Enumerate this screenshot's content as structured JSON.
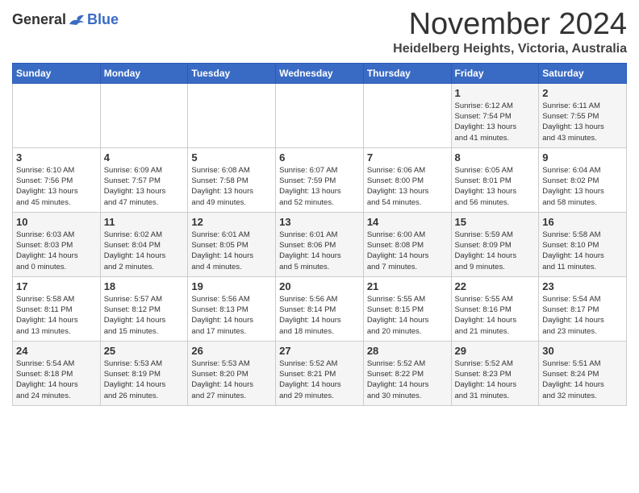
{
  "logo": {
    "general": "General",
    "blue": "Blue"
  },
  "header": {
    "month": "November 2024",
    "location": "Heidelberg Heights, Victoria, Australia"
  },
  "weekdays": [
    "Sunday",
    "Monday",
    "Tuesday",
    "Wednesday",
    "Thursday",
    "Friday",
    "Saturday"
  ],
  "weeks": [
    [
      {
        "day": "",
        "info": ""
      },
      {
        "day": "",
        "info": ""
      },
      {
        "day": "",
        "info": ""
      },
      {
        "day": "",
        "info": ""
      },
      {
        "day": "",
        "info": ""
      },
      {
        "day": "1",
        "info": "Sunrise: 6:12 AM\nSunset: 7:54 PM\nDaylight: 13 hours\nand 41 minutes."
      },
      {
        "day": "2",
        "info": "Sunrise: 6:11 AM\nSunset: 7:55 PM\nDaylight: 13 hours\nand 43 minutes."
      }
    ],
    [
      {
        "day": "3",
        "info": "Sunrise: 6:10 AM\nSunset: 7:56 PM\nDaylight: 13 hours\nand 45 minutes."
      },
      {
        "day": "4",
        "info": "Sunrise: 6:09 AM\nSunset: 7:57 PM\nDaylight: 13 hours\nand 47 minutes."
      },
      {
        "day": "5",
        "info": "Sunrise: 6:08 AM\nSunset: 7:58 PM\nDaylight: 13 hours\nand 49 minutes."
      },
      {
        "day": "6",
        "info": "Sunrise: 6:07 AM\nSunset: 7:59 PM\nDaylight: 13 hours\nand 52 minutes."
      },
      {
        "day": "7",
        "info": "Sunrise: 6:06 AM\nSunset: 8:00 PM\nDaylight: 13 hours\nand 54 minutes."
      },
      {
        "day": "8",
        "info": "Sunrise: 6:05 AM\nSunset: 8:01 PM\nDaylight: 13 hours\nand 56 minutes."
      },
      {
        "day": "9",
        "info": "Sunrise: 6:04 AM\nSunset: 8:02 PM\nDaylight: 13 hours\nand 58 minutes."
      }
    ],
    [
      {
        "day": "10",
        "info": "Sunrise: 6:03 AM\nSunset: 8:03 PM\nDaylight: 14 hours\nand 0 minutes."
      },
      {
        "day": "11",
        "info": "Sunrise: 6:02 AM\nSunset: 8:04 PM\nDaylight: 14 hours\nand 2 minutes."
      },
      {
        "day": "12",
        "info": "Sunrise: 6:01 AM\nSunset: 8:05 PM\nDaylight: 14 hours\nand 4 minutes."
      },
      {
        "day": "13",
        "info": "Sunrise: 6:01 AM\nSunset: 8:06 PM\nDaylight: 14 hours\nand 5 minutes."
      },
      {
        "day": "14",
        "info": "Sunrise: 6:00 AM\nSunset: 8:08 PM\nDaylight: 14 hours\nand 7 minutes."
      },
      {
        "day": "15",
        "info": "Sunrise: 5:59 AM\nSunset: 8:09 PM\nDaylight: 14 hours\nand 9 minutes."
      },
      {
        "day": "16",
        "info": "Sunrise: 5:58 AM\nSunset: 8:10 PM\nDaylight: 14 hours\nand 11 minutes."
      }
    ],
    [
      {
        "day": "17",
        "info": "Sunrise: 5:58 AM\nSunset: 8:11 PM\nDaylight: 14 hours\nand 13 minutes."
      },
      {
        "day": "18",
        "info": "Sunrise: 5:57 AM\nSunset: 8:12 PM\nDaylight: 14 hours\nand 15 minutes."
      },
      {
        "day": "19",
        "info": "Sunrise: 5:56 AM\nSunset: 8:13 PM\nDaylight: 14 hours\nand 17 minutes."
      },
      {
        "day": "20",
        "info": "Sunrise: 5:56 AM\nSunset: 8:14 PM\nDaylight: 14 hours\nand 18 minutes."
      },
      {
        "day": "21",
        "info": "Sunrise: 5:55 AM\nSunset: 8:15 PM\nDaylight: 14 hours\nand 20 minutes."
      },
      {
        "day": "22",
        "info": "Sunrise: 5:55 AM\nSunset: 8:16 PM\nDaylight: 14 hours\nand 21 minutes."
      },
      {
        "day": "23",
        "info": "Sunrise: 5:54 AM\nSunset: 8:17 PM\nDaylight: 14 hours\nand 23 minutes."
      }
    ],
    [
      {
        "day": "24",
        "info": "Sunrise: 5:54 AM\nSunset: 8:18 PM\nDaylight: 14 hours\nand 24 minutes."
      },
      {
        "day": "25",
        "info": "Sunrise: 5:53 AM\nSunset: 8:19 PM\nDaylight: 14 hours\nand 26 minutes."
      },
      {
        "day": "26",
        "info": "Sunrise: 5:53 AM\nSunset: 8:20 PM\nDaylight: 14 hours\nand 27 minutes."
      },
      {
        "day": "27",
        "info": "Sunrise: 5:52 AM\nSunset: 8:21 PM\nDaylight: 14 hours\nand 29 minutes."
      },
      {
        "day": "28",
        "info": "Sunrise: 5:52 AM\nSunset: 8:22 PM\nDaylight: 14 hours\nand 30 minutes."
      },
      {
        "day": "29",
        "info": "Sunrise: 5:52 AM\nSunset: 8:23 PM\nDaylight: 14 hours\nand 31 minutes."
      },
      {
        "day": "30",
        "info": "Sunrise: 5:51 AM\nSunset: 8:24 PM\nDaylight: 14 hours\nand 32 minutes."
      }
    ]
  ]
}
